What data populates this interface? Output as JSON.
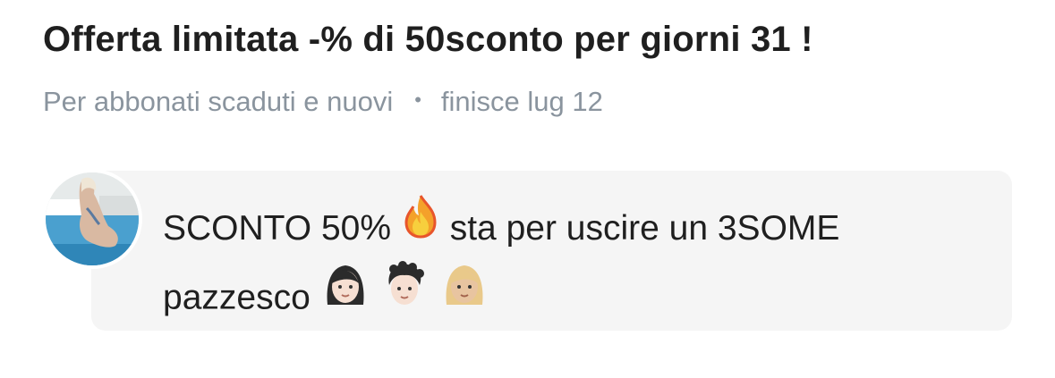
{
  "promo": {
    "title": "Offerta limitata -% di 50sconto per giorni 31 !",
    "audience": "Per abbonati scaduti e nuovi",
    "separator": "•",
    "expiry": "finisce lug 12"
  },
  "message": {
    "line1_start": "SCONTO 50%",
    "line1_end": "sta per uscire un 3SOME",
    "line2": "pazzesco",
    "emojis": [
      "fire-emoji",
      "woman-emoji",
      "man-emoji",
      "blond-woman-emoji"
    ]
  },
  "avatar": {
    "alt": "creator-avatar"
  }
}
